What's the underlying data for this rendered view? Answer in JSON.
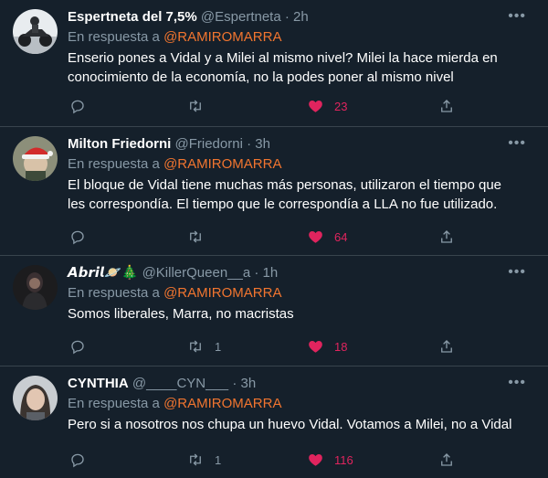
{
  "reply_label": "En respuesta a",
  "tweets": [
    {
      "name": "Espertneta del 7,5%",
      "handle": "@Espertneta",
      "time": "2h",
      "reply_to": "@RAMIROMARRA",
      "text": "Enserio pones a Vidal y a Milei al mismo nivel? Milei la hace mierda en conocimiento de la economía, no la podes poner al mismo nivel",
      "retweets": "",
      "likes": "23",
      "avatar": "avatar-motorcycle"
    },
    {
      "name": "Milton Friedorni",
      "handle": "@Friedorni",
      "time": "3h",
      "reply_to": "@RAMIROMARRA",
      "text": "El bloque de Vidal tiene muchas más personas, utilizaron el tiempo que les correspondía. El tiempo que le correspondía a LLA no fue utilizado.",
      "retweets": "",
      "likes": "64",
      "avatar": "avatar-santa-hat"
    },
    {
      "name": "𝘼𝙗𝙧𝙞𝙡🪐🎄",
      "handle": "@KillerQueen__a",
      "time": "1h",
      "reply_to": "@RAMIROMARRA",
      "text": "Somos liberales, Marra, no macristas",
      "retweets": "1",
      "likes": "18",
      "avatar": "avatar-woman-dark"
    },
    {
      "name": "CYNTHIA",
      "handle": "@____CYN___",
      "time": "3h",
      "reply_to": "@RAMIROMARRA",
      "text": "Pero si a nosotros nos chupa un huevo Vidal. Votamos a Milei, no a Vidal",
      "retweets": "1",
      "likes": "116",
      "avatar": "avatar-girl"
    }
  ],
  "colors": {
    "background": "#15202b",
    "mention": "#f1752f",
    "like": "#e0245e",
    "muted": "#8899a6",
    "divider": "#38444d"
  }
}
